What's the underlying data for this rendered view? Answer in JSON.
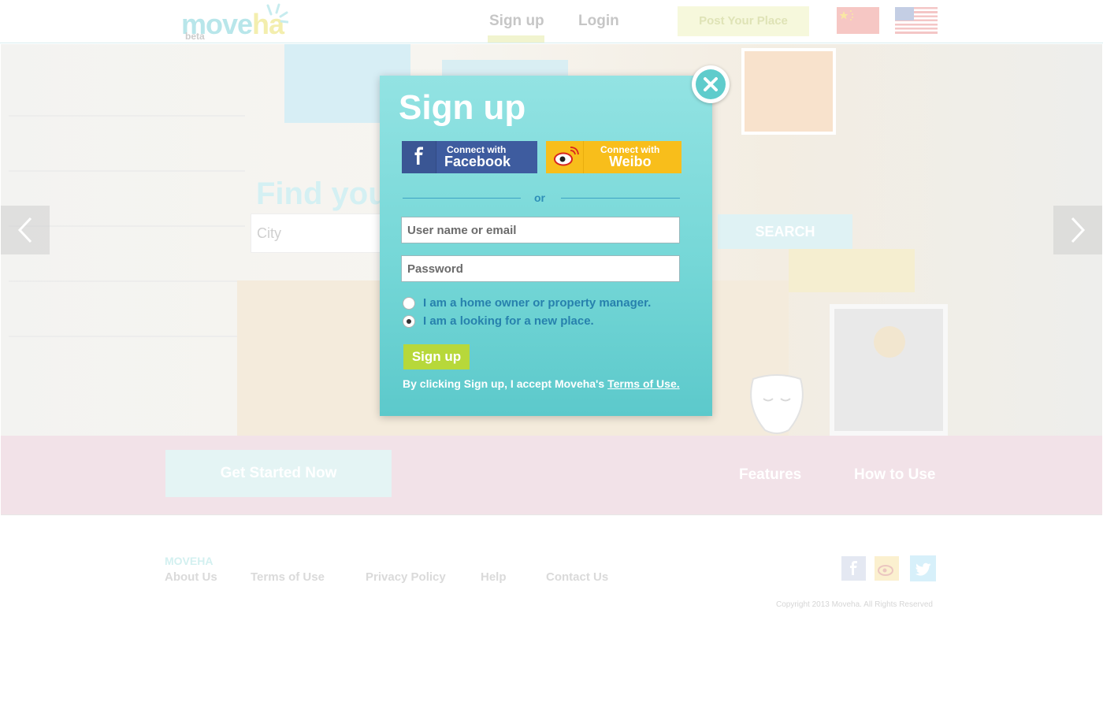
{
  "header": {
    "logo_word_a": "move",
    "logo_word_b": "ha",
    "logo_tag": "beta",
    "nav_signup": "Sign up",
    "nav_login": "Login",
    "post_place": "Post Your Place",
    "flags": [
      "china-flag-icon",
      "usa-flag-icon"
    ]
  },
  "hero": {
    "title_visible": "Find you",
    "city_placeholder": "City",
    "search_label": "SEARCH",
    "arrows": [
      "chevron-left-icon",
      "chevron-right-icon"
    ]
  },
  "band": {
    "cta_label": "Get Started Now",
    "features_label": "Features",
    "howto_label": "How to Use"
  },
  "footer": {
    "brand": "MOVEHA",
    "links": [
      "About Us",
      "Terms of Use",
      "Privacy Policy",
      "Help",
      "Contact Us"
    ],
    "social": [
      "facebook-icon",
      "weibo-icon",
      "twitter-icon"
    ],
    "copyright": "Copyright 2013 Moveha.  All Rights Reserved"
  },
  "modal": {
    "title": "Sign up",
    "facebook_small": "Connect with",
    "facebook_big": "Facebook",
    "weibo_small": "Connect with",
    "weibo_big": "Weibo",
    "or_text": "or",
    "username_placeholder": "User name or email",
    "password_placeholder": "Password",
    "radio_options": [
      {
        "label": "I am a home owner or property manager.",
        "selected": false
      },
      {
        "label": "I am a looking for a new place.",
        "selected": true
      }
    ],
    "submit_label": "Sign up",
    "terms_prefix": "By clicking Sign up, I accept Moveha's ",
    "terms_link": "Terms of Use.",
    "close_icon": "close-icon"
  },
  "colors": {
    "modal_top": "#93e3e3",
    "modal_bottom": "#5cc9cb",
    "facebook": "#3e5c9f",
    "weibo": "#f8be1b",
    "submit": "#b7d83a",
    "radio_text": "#2781ad"
  }
}
